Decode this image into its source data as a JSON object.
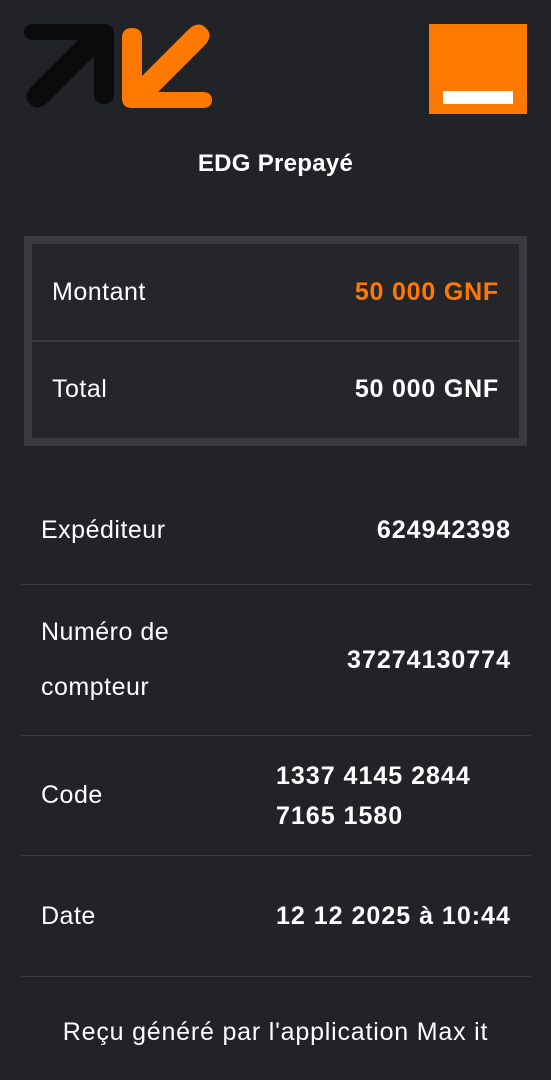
{
  "header": {
    "title": "EDG Prepayé"
  },
  "amount": {
    "montant_label": "Montant",
    "montant_value": "50 000 GNF",
    "total_label": "Total",
    "total_value": "50 000 GNF"
  },
  "details": {
    "expediteur_label": "Expéditeur",
    "expediteur_value": "624942398",
    "compteur_label": "Numéro de compteur",
    "compteur_value": "37274130774",
    "code_label": "Code",
    "code_value": "1337 4145 2844 7165 1580",
    "date_label": "Date",
    "date_value": "12 12 2025 à 10:44"
  },
  "footer": {
    "text": "Reçu généré par l'application Max it"
  },
  "colors": {
    "background": "#222327",
    "accent": "#ff7900",
    "text": "#ffffff"
  },
  "icons": {
    "app_logo": "max-it-arrows-icon",
    "brand_logo": "orange-logo"
  }
}
